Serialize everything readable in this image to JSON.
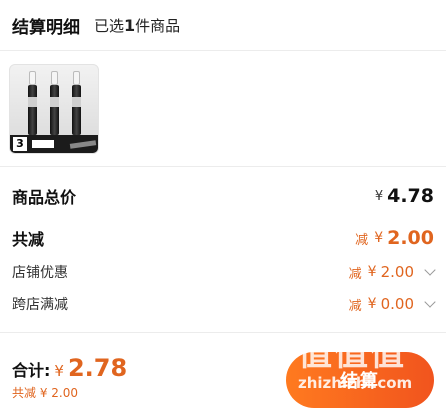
{
  "header": {
    "title": "结算明细",
    "sub_prefix": "已选",
    "count": "1",
    "sub_suffix": "件商品"
  },
  "product": {
    "thumbnail_icon": "pen-set-thumbnail",
    "pack_count": "3"
  },
  "summary": {
    "total_label": "商品总价",
    "total_currency": "¥",
    "total_value": "4.78",
    "discount_label": "共减",
    "discount_tag": "减",
    "discount_currency": "¥",
    "discount_value": "2.00"
  },
  "discounts": [
    {
      "label": "店铺优惠",
      "tag": "减",
      "currency": "¥",
      "value": "2.00"
    },
    {
      "label": "跨店满减",
      "tag": "减",
      "currency": "¥",
      "value": "0.00"
    }
  ],
  "footer": {
    "total_label": "合计:",
    "total_currency": "¥",
    "total_value": "2.78",
    "discount_note": "共减 ¥ 2.00",
    "checkout_label": "结算"
  },
  "watermark": {
    "logo": "值值值",
    "url": "zhizhizhi.com"
  },
  "colors": {
    "accent": "#e0651f",
    "button_start": "#ff7a1f",
    "button_end": "#f1541e"
  }
}
